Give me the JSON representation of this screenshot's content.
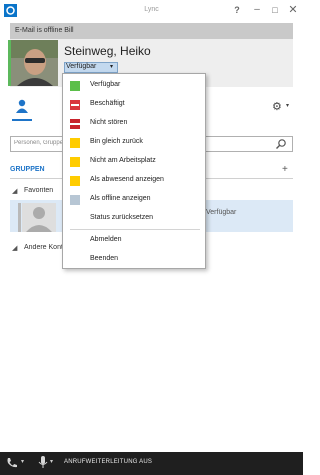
{
  "window": {
    "title": "Lync",
    "help_glyph": "?",
    "minimize_glyph": "–",
    "maximize_glyph": "□",
    "close_glyph": "✕"
  },
  "profile": {
    "note": "E-Mail is offline Bill",
    "name": "Steinweg, Heiko",
    "status_label": "Verfügbar",
    "status_arrow": "▾",
    "presence_color": "#5cb85c"
  },
  "toolbar": {
    "options_glyph": "⚙",
    "options_arrow": "▾"
  },
  "search": {
    "placeholder": "Personen, Gruppen oder Nummern suchen"
  },
  "groups": {
    "header": "GRUPPEN",
    "add_glyph": "+",
    "chevron": "◢",
    "first_group": "Favoriten",
    "contact_text": "Verfügbar",
    "other_group": "Andere Kontakte"
  },
  "status_menu": {
    "items": [
      {
        "label": "Verfügbar",
        "color": "#5bbf4a",
        "style": "plain"
      },
      {
        "label": "Beschäftigt",
        "color": "#d9363e",
        "style": "dnd"
      },
      {
        "label": "Nicht stören",
        "color": "#c8232c",
        "style": "busy"
      },
      {
        "label": "Bin gleich zurück",
        "color": "#ffcc00",
        "style": "plain"
      },
      {
        "label": "Nicht am Arbeitsplatz",
        "color": "#ffcc00",
        "style": "plain"
      },
      {
        "label": "Als abwesend anzeigen",
        "color": "#ffcc00",
        "style": "plain"
      },
      {
        "label": "Als offline anzeigen",
        "color": "#b7c6d4",
        "style": "plain"
      },
      {
        "label": "Status zurücksetzen",
        "color": "",
        "style": "none"
      }
    ],
    "extra": [
      {
        "label": "Abmelden"
      },
      {
        "label": "Beenden"
      }
    ]
  },
  "bottom": {
    "phone_arrow": "▾",
    "mic_arrow": "▾",
    "forward_text": "ANRUFWEITERLEITUNG AUS"
  }
}
